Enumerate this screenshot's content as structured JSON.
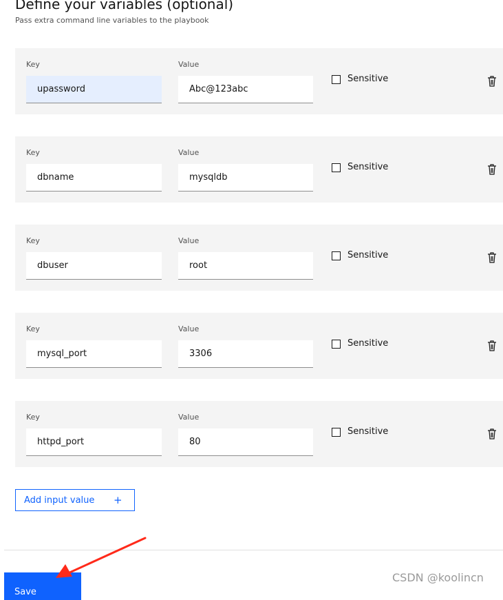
{
  "header": {
    "title": "Define your variables (optional)",
    "subtitle": "Pass extra command line variables to the playbook"
  },
  "variables": [
    {
      "key_label": "Key",
      "value_label": "Value",
      "key": "upassword",
      "value": "Abc@123abc",
      "sensitive_label": "Sensitive",
      "sensitive": false
    },
    {
      "key_label": "Key",
      "value_label": "Value",
      "key": "dbname",
      "value": "mysqldb",
      "sensitive_label": "Sensitive",
      "sensitive": false
    },
    {
      "key_label": "Key",
      "value_label": "Value",
      "key": "dbuser",
      "value": "root",
      "sensitive_label": "Sensitive",
      "sensitive": false
    },
    {
      "key_label": "Key",
      "value_label": "Value",
      "key": "mysql_port",
      "value": "3306",
      "sensitive_label": "Sensitive",
      "sensitive": false
    },
    {
      "key_label": "Key",
      "value_label": "Value",
      "key": "httpd_port",
      "value": "80",
      "sensitive_label": "Sensitive",
      "sensitive": false
    }
  ],
  "add_button": {
    "label": "Add input value",
    "icon": "+"
  },
  "save_button": {
    "label": "Save"
  },
  "watermark": "CSDN @koolincn",
  "colors": {
    "primary": "#0f62fe",
    "row_background": "#f4f4f4",
    "focused_input": "#e5eefe",
    "annotation_arrow": "#ff2a1a"
  }
}
